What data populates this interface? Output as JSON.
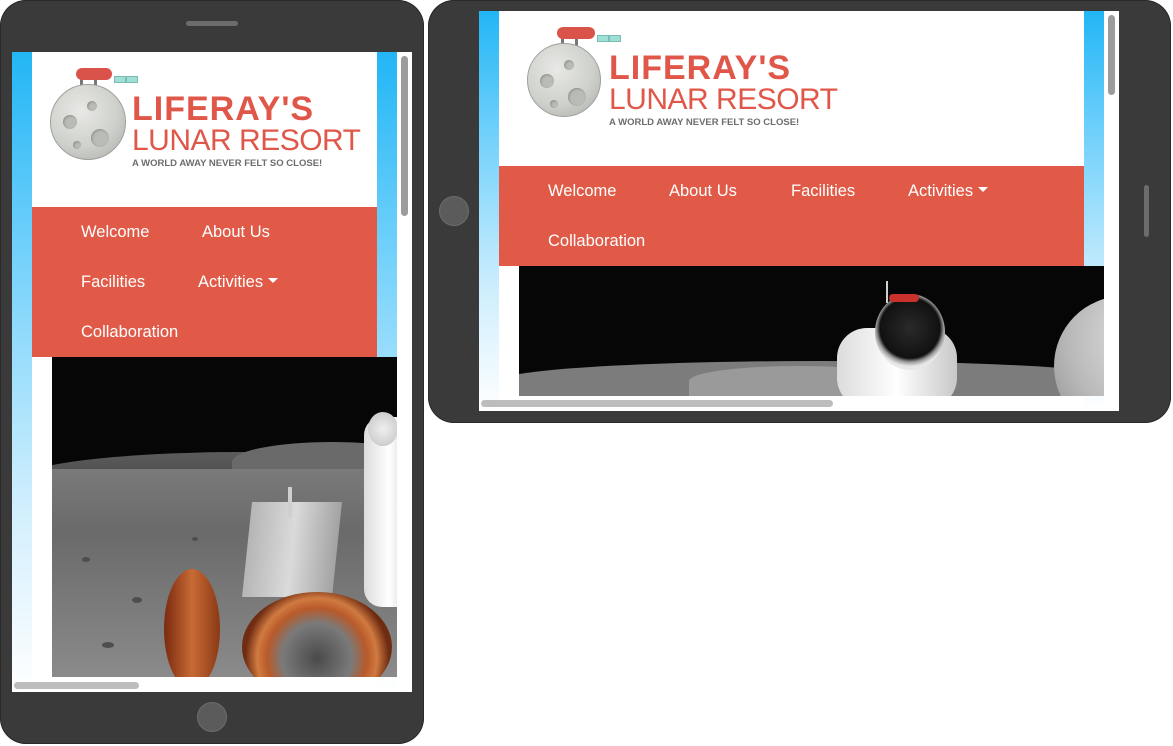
{
  "site": {
    "logo_title": "LIFERAY'S",
    "logo_subtitle": "LUNAR RESORT",
    "tagline": "A WORLD AWAY NEVER FELT SO CLOSE!"
  },
  "nav": {
    "items": [
      {
        "label": "Welcome"
      },
      {
        "label": "About Us"
      },
      {
        "label": "Facilities"
      },
      {
        "label": "Activities"
      },
      {
        "label": "Collaboration"
      }
    ]
  },
  "colors": {
    "nav_background": "#e05a47",
    "brand_red": "#e0574a",
    "device_frame": "#3a3a3a",
    "side_gradient": "#22b6f5"
  },
  "icons": {
    "dropdown": "caret-down-icon"
  }
}
